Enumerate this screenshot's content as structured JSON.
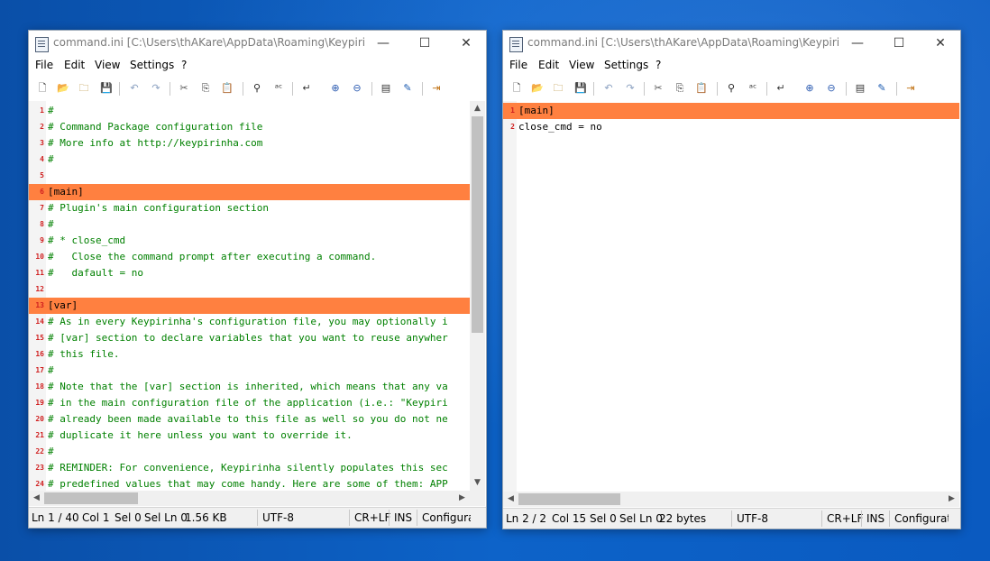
{
  "windows": [
    {
      "title": "command.ini [C:\\Users\\thAKare\\AppData\\Roaming\\Keypirinh...",
      "menu": [
        "File",
        "Edit",
        "View",
        "Settings",
        "?"
      ],
      "lines": [
        {
          "n": "1",
          "t": "#",
          "k": "cmt"
        },
        {
          "n": "2",
          "t": "# Command Package configuration file",
          "k": "cmt"
        },
        {
          "n": "3",
          "t": "# More info at http://keypirinha.com",
          "k": "cmt"
        },
        {
          "n": "4",
          "t": "#",
          "k": "cmt"
        },
        {
          "n": "5",
          "t": "",
          "k": "plain"
        },
        {
          "n": "6",
          "t": "[main]",
          "k": "sect"
        },
        {
          "n": "7",
          "t": "# Plugin's main configuration section",
          "k": "cmt"
        },
        {
          "n": "8",
          "t": "#",
          "k": "cmt"
        },
        {
          "n": "9",
          "t": "# * close_cmd",
          "k": "cmt"
        },
        {
          "n": "10",
          "t": "#   Close the command prompt after executing a command.",
          "k": "cmt"
        },
        {
          "n": "11",
          "t": "#   dafault = no",
          "k": "cmt"
        },
        {
          "n": "12",
          "t": "",
          "k": "plain"
        },
        {
          "n": "13",
          "t": "[var]",
          "k": "sect"
        },
        {
          "n": "14",
          "t": "# As in every Keypirinha's configuration file, you may optionally i",
          "k": "cmt"
        },
        {
          "n": "15",
          "t": "# [var] section to declare variables that you want to reuse anywher",
          "k": "cmt"
        },
        {
          "n": "16",
          "t": "# this file.",
          "k": "cmt"
        },
        {
          "n": "17",
          "t": "#",
          "k": "cmt"
        },
        {
          "n": "18",
          "t": "# Note that the [var] section is inherited, which means that any va",
          "k": "cmt"
        },
        {
          "n": "19",
          "t": "# in the main configuration file of the application (i.e.: \"Keypiri",
          "k": "cmt"
        },
        {
          "n": "20",
          "t": "# already been made available to this file as well so you do not ne",
          "k": "cmt"
        },
        {
          "n": "21",
          "t": "# duplicate it here unless you want to override it.",
          "k": "cmt"
        },
        {
          "n": "22",
          "t": "#",
          "k": "cmt"
        },
        {
          "n": "23",
          "t": "# REMINDER: For convenience, Keypirinha silently populates this sec",
          "k": "cmt"
        },
        {
          "n": "24",
          "t": "# predefined values that may come handy. Here are some of them: APP",
          "k": "cmt"
        }
      ],
      "status": {
        "ln": "Ln 1 / 40",
        "col": "Col 1",
        "sel": "Sel 0",
        "selln": "Sel Ln 0",
        "size": "1.56 KB",
        "enc": "UTF-8",
        "eol": "CR+LF",
        "ins": "INS",
        "scheme": "Configurat"
      }
    },
    {
      "title": "command.ini [C:\\Users\\thAKare\\AppData\\Roaming\\Keypirinh...",
      "menu": [
        "File",
        "Edit",
        "View",
        "Settings",
        "?"
      ],
      "lines": [
        {
          "n": "1",
          "t": "[main]",
          "k": "sect"
        },
        {
          "n": "2",
          "t": "close_cmd = no",
          "k": "plain"
        }
      ],
      "status": {
        "ln": "Ln 2 / 2",
        "col": "Col 15",
        "sel": "Sel 0",
        "selln": "Sel Ln 0",
        "size": "22 bytes",
        "enc": "UTF-8",
        "eol": "CR+LF",
        "ins": "INS",
        "scheme": "Configurat"
      }
    }
  ],
  "colors": {
    "highlight": "#ff8040",
    "comment": "#008000",
    "line_number": "#d02020"
  },
  "icons": [
    "new-file-icon",
    "open-icon",
    "browse-icon",
    "save-icon",
    "undo-icon",
    "redo-icon",
    "cut-icon",
    "copy-icon",
    "paste-icon",
    "find-icon",
    "replace-icon",
    "wordwrap-icon",
    "zoom-in-icon",
    "zoom-out-icon",
    "view-icon",
    "edit-scheme-icon",
    "exit-icon"
  ]
}
